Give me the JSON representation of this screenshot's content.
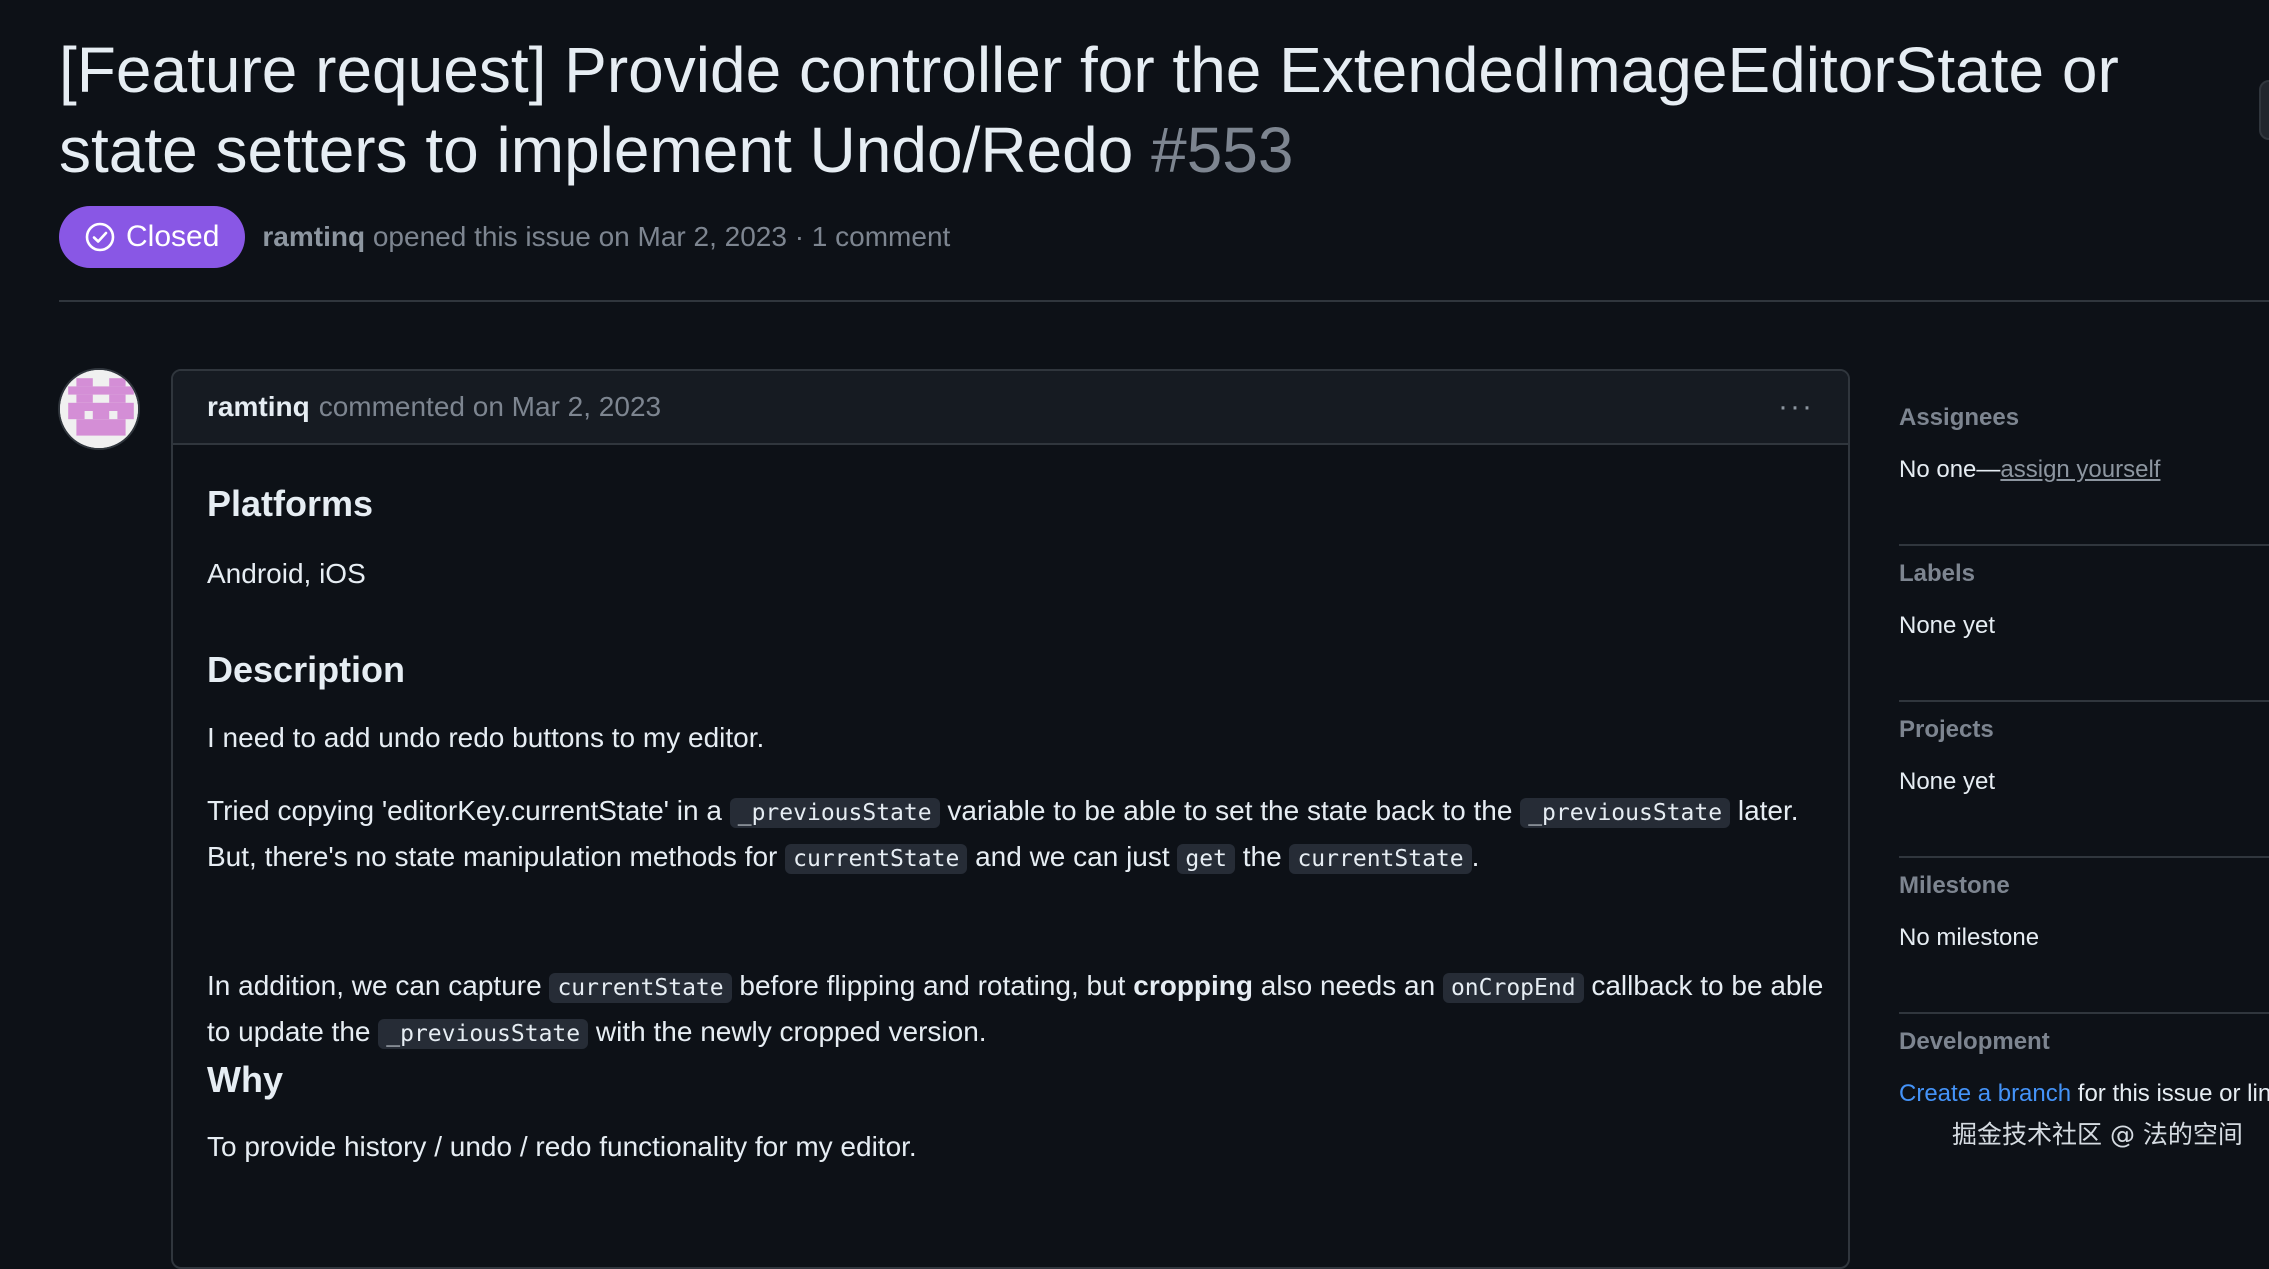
{
  "issue": {
    "title": "[Feature request] Provide controller for the ExtendedImageEditorState or state setters to implement Undo/Redo",
    "number": "#553",
    "state": "Closed",
    "author": "ramtinq",
    "meta": "opened this issue on Mar 2, 2023 · 1 comment"
  },
  "comment": {
    "author": "ramtinq",
    "meta": "commented on Mar 2, 2023",
    "more": "···",
    "h_platforms": "Platforms",
    "platforms": "Android, iOS",
    "h_description": "Description",
    "desc1": "I need to add undo redo buttons to my editor.",
    "desc2": {
      "t1": "Tried copying 'editorKey.currentState' in a ",
      "c1": "_previousState",
      "t2": " variable to be able to set the state back to the ",
      "c2": "_previousState",
      "t3": " later. But, there's no state manipulation methods for ",
      "c3": "currentState",
      "t4": " and we can just ",
      "c4": "get",
      "t5": " the ",
      "c5": "currentState",
      "t6": "."
    },
    "desc3": {
      "t1": "In addition, we can capture ",
      "c1": "currentState",
      "t2": " before flipping and rotating, but ",
      "b1": "cropping",
      "t3": " also needs an ",
      "c2": "onCropEnd",
      "t4": " callback to be able to update the ",
      "c3": "_previousState",
      "t5": " with the newly cropped version."
    },
    "h_why": "Why",
    "why": "To provide history / undo / redo functionality for my editor."
  },
  "sidebar": {
    "assignees_label": "Assignees",
    "assignees_prefix": "No one—",
    "assignees_link": "assign yourself",
    "labels_label": "Labels",
    "labels_value": "None yet",
    "projects_label": "Projects",
    "projects_value": "None yet",
    "milestone_label": "Milestone",
    "milestone_value": "No milestone",
    "development_label": "Development",
    "development_link": "Create a branch",
    "development_suffix": " for this issue or link"
  },
  "watermark": "掘金技术社区 @ 法的空间",
  "colors": {
    "closed": "#8957e5",
    "bg": "#0d1117",
    "link": "#4493f8"
  }
}
